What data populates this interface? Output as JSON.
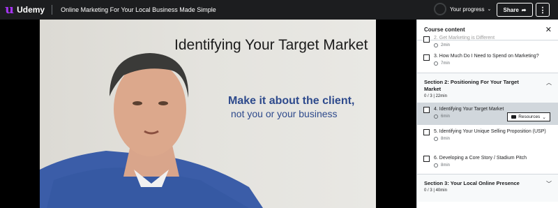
{
  "header": {
    "logo_mark": "u",
    "logo_text": "Udemy",
    "course_title": "Online Marketing For Your Local Business Made Simple",
    "progress_label": "Your progress",
    "share_label": "Share",
    "more_label": "⋮"
  },
  "video": {
    "slide_title": "Identifying Your Target Market",
    "slide_line1": "Make it about the client,",
    "slide_line2": "not you or your business"
  },
  "sidebar": {
    "title": "Course content",
    "close": "✕",
    "partial_item": {
      "title": "2. Get Marketing is Different",
      "duration": "2min"
    },
    "item3": {
      "title": "3. How Much Do I Need to Spend on Marketing?",
      "duration": "7min"
    },
    "section2": {
      "title": "Section 2: Positioning For Your Target Market",
      "meta": "0 / 3 | 22min"
    },
    "items2": [
      {
        "title": "4. Identifying Your Target Market",
        "duration": "6min",
        "resources": "Resources"
      },
      {
        "title": "5. Identifying Your Unique Selling Proposition (USP)",
        "duration": "8min"
      },
      {
        "title": "6. Developing a Core Story / Stadium Pitch",
        "duration": "8min"
      }
    ],
    "section3": {
      "title": "Section 3: Your Local Online Presence",
      "meta": "0 / 3 | 40min"
    }
  },
  "colors": {
    "topbar": "#1c1d1f",
    "brand": "#a435f0",
    "slide_text": "#2e4a8c"
  }
}
